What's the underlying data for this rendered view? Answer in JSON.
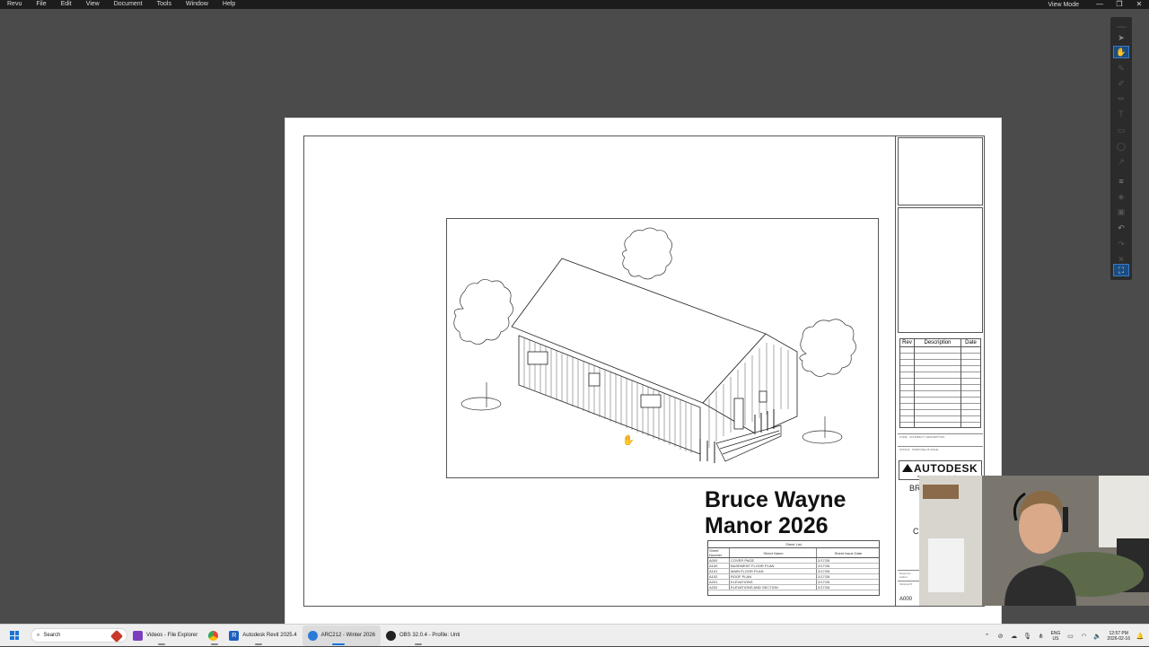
{
  "menubar": {
    "app": "Revu",
    "items": [
      "File",
      "Edit",
      "View",
      "Document",
      "Tools",
      "Window",
      "Help"
    ],
    "view_mode": "View Mode",
    "minimize": "—",
    "restore": "❐",
    "close": "✕"
  },
  "sheet": {
    "project_title_line1": "Bruce Wayne",
    "project_title_line2": "Manor 2026",
    "revision_table": {
      "headers": [
        "Rev",
        "Description",
        "Date"
      ]
    },
    "fields": [
      {
        "label": "CODE",
        "value": "SUITABILITY DESCRIPTION"
      },
      {
        "label": "STATUS",
        "value": "PURPOSE OF ISSUE"
      }
    ],
    "logo": {
      "name": "AUTODESK",
      "url": "www.autodesk.com/revit"
    },
    "owner_partial": "BR",
    "title_partial": "C",
    "drawn_by_label": "Drawn by",
    "drawn_by": "Author",
    "scale_label": "SCALE AT ",
    "sheet_number": "A000",
    "sheet_list": {
      "title": "Sheet List",
      "headers": [
        "Sheet Number",
        "Sheet Name",
        "Sheet Issue Date"
      ],
      "rows": [
        [
          "A000",
          "COVER PAGE",
          "2/17/26"
        ],
        [
          "A100",
          "BASEMENT FLOOR PLAN",
          "2/17/26"
        ],
        [
          "A101",
          "MAIN FLOOR PLAN",
          "2/17/26"
        ],
        [
          "A102",
          "ROOF PLAN",
          "2/17/26"
        ],
        [
          "A201",
          "ELEVATIONS",
          "2/17/26"
        ],
        [
          "A202",
          "ELEVATIONS AND SECTION",
          "2/17/26"
        ]
      ]
    }
  },
  "toolbar": {
    "tools": [
      {
        "name": "select-tool",
        "glyph": "➤",
        "state": "normal"
      },
      {
        "name": "pan-tool",
        "glyph": "✋",
        "state": "active"
      },
      {
        "name": "pen-tool",
        "glyph": "✎",
        "state": "dim"
      },
      {
        "name": "highlight-tool",
        "glyph": "✐",
        "state": "dim"
      },
      {
        "name": "eraser-tool",
        "glyph": "✏",
        "state": "dim"
      },
      {
        "name": "text-tool",
        "glyph": "T",
        "state": "dim"
      },
      {
        "name": "rectangle-tool",
        "glyph": "▭",
        "state": "dim"
      },
      {
        "name": "ellipse-tool",
        "glyph": "◯",
        "state": "dim"
      },
      {
        "name": "arrow-tool",
        "glyph": "↗",
        "state": "dim"
      },
      {
        "name": "line-weight-tool",
        "glyph": "≡",
        "state": "normal"
      },
      {
        "name": "color-tool",
        "glyph": "◈",
        "state": "dim"
      },
      {
        "name": "stamp-tool",
        "glyph": "▣",
        "state": "dim"
      },
      {
        "name": "undo-tool",
        "glyph": "↶",
        "state": "normal"
      },
      {
        "name": "redo-tool",
        "glyph": "↷",
        "state": "dim"
      },
      {
        "name": "delete-tool",
        "glyph": "✕",
        "state": "dim"
      },
      {
        "name": "fit-screen-tool",
        "glyph": "⛶",
        "state": "active"
      }
    ]
  },
  "taskbar": {
    "search_placeholder": "Search",
    "apps": [
      {
        "name": "Videos - File Explorer",
        "color": "#7b3fbf"
      },
      {
        "name": "",
        "color": "#ea4335"
      },
      {
        "name": "Autodesk Revit 2025.4",
        "color": "#1d5fbf"
      },
      {
        "name": "ARC212 - Winter 2026",
        "color": "#2a7ad8"
      },
      {
        "name": "OBS 32.0.4 - Profile: Unti",
        "color": "#222222"
      }
    ],
    "lang_top": "ENG",
    "lang_bottom": "US",
    "time": "12:57 PM",
    "date": "2026-02-16"
  }
}
